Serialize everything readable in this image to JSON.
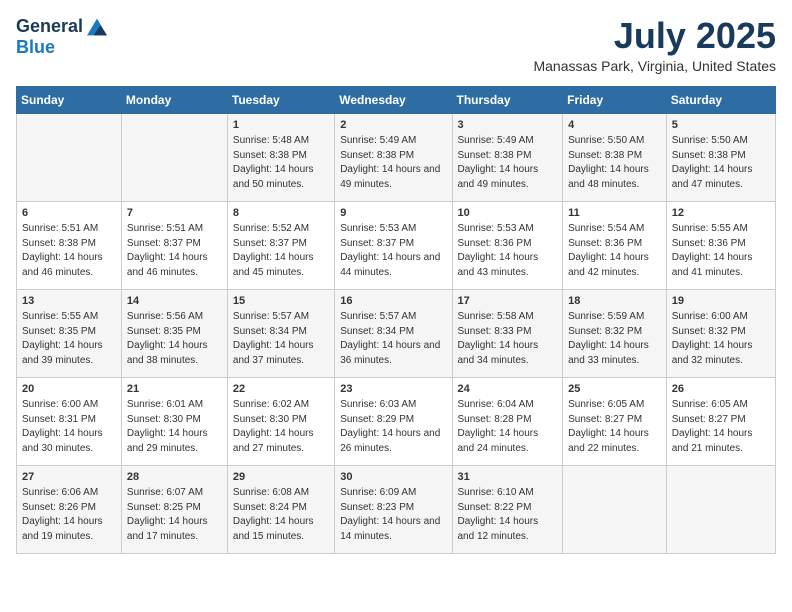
{
  "header": {
    "logo_general": "General",
    "logo_blue": "Blue",
    "month_title": "July 2025",
    "location": "Manassas Park, Virginia, United States"
  },
  "days_of_week": [
    "Sunday",
    "Monday",
    "Tuesday",
    "Wednesday",
    "Thursday",
    "Friday",
    "Saturday"
  ],
  "weeks": [
    [
      {
        "day": "",
        "info": ""
      },
      {
        "day": "",
        "info": ""
      },
      {
        "day": "1",
        "info": "Sunrise: 5:48 AM\nSunset: 8:38 PM\nDaylight: 14 hours and 50 minutes."
      },
      {
        "day": "2",
        "info": "Sunrise: 5:49 AM\nSunset: 8:38 PM\nDaylight: 14 hours and 49 minutes."
      },
      {
        "day": "3",
        "info": "Sunrise: 5:49 AM\nSunset: 8:38 PM\nDaylight: 14 hours and 49 minutes."
      },
      {
        "day": "4",
        "info": "Sunrise: 5:50 AM\nSunset: 8:38 PM\nDaylight: 14 hours and 48 minutes."
      },
      {
        "day": "5",
        "info": "Sunrise: 5:50 AM\nSunset: 8:38 PM\nDaylight: 14 hours and 47 minutes."
      }
    ],
    [
      {
        "day": "6",
        "info": "Sunrise: 5:51 AM\nSunset: 8:38 PM\nDaylight: 14 hours and 46 minutes."
      },
      {
        "day": "7",
        "info": "Sunrise: 5:51 AM\nSunset: 8:37 PM\nDaylight: 14 hours and 46 minutes."
      },
      {
        "day": "8",
        "info": "Sunrise: 5:52 AM\nSunset: 8:37 PM\nDaylight: 14 hours and 45 minutes."
      },
      {
        "day": "9",
        "info": "Sunrise: 5:53 AM\nSunset: 8:37 PM\nDaylight: 14 hours and 44 minutes."
      },
      {
        "day": "10",
        "info": "Sunrise: 5:53 AM\nSunset: 8:36 PM\nDaylight: 14 hours and 43 minutes."
      },
      {
        "day": "11",
        "info": "Sunrise: 5:54 AM\nSunset: 8:36 PM\nDaylight: 14 hours and 42 minutes."
      },
      {
        "day": "12",
        "info": "Sunrise: 5:55 AM\nSunset: 8:36 PM\nDaylight: 14 hours and 41 minutes."
      }
    ],
    [
      {
        "day": "13",
        "info": "Sunrise: 5:55 AM\nSunset: 8:35 PM\nDaylight: 14 hours and 39 minutes."
      },
      {
        "day": "14",
        "info": "Sunrise: 5:56 AM\nSunset: 8:35 PM\nDaylight: 14 hours and 38 minutes."
      },
      {
        "day": "15",
        "info": "Sunrise: 5:57 AM\nSunset: 8:34 PM\nDaylight: 14 hours and 37 minutes."
      },
      {
        "day": "16",
        "info": "Sunrise: 5:57 AM\nSunset: 8:34 PM\nDaylight: 14 hours and 36 minutes."
      },
      {
        "day": "17",
        "info": "Sunrise: 5:58 AM\nSunset: 8:33 PM\nDaylight: 14 hours and 34 minutes."
      },
      {
        "day": "18",
        "info": "Sunrise: 5:59 AM\nSunset: 8:32 PM\nDaylight: 14 hours and 33 minutes."
      },
      {
        "day": "19",
        "info": "Sunrise: 6:00 AM\nSunset: 8:32 PM\nDaylight: 14 hours and 32 minutes."
      }
    ],
    [
      {
        "day": "20",
        "info": "Sunrise: 6:00 AM\nSunset: 8:31 PM\nDaylight: 14 hours and 30 minutes."
      },
      {
        "day": "21",
        "info": "Sunrise: 6:01 AM\nSunset: 8:30 PM\nDaylight: 14 hours and 29 minutes."
      },
      {
        "day": "22",
        "info": "Sunrise: 6:02 AM\nSunset: 8:30 PM\nDaylight: 14 hours and 27 minutes."
      },
      {
        "day": "23",
        "info": "Sunrise: 6:03 AM\nSunset: 8:29 PM\nDaylight: 14 hours and 26 minutes."
      },
      {
        "day": "24",
        "info": "Sunrise: 6:04 AM\nSunset: 8:28 PM\nDaylight: 14 hours and 24 minutes."
      },
      {
        "day": "25",
        "info": "Sunrise: 6:05 AM\nSunset: 8:27 PM\nDaylight: 14 hours and 22 minutes."
      },
      {
        "day": "26",
        "info": "Sunrise: 6:05 AM\nSunset: 8:27 PM\nDaylight: 14 hours and 21 minutes."
      }
    ],
    [
      {
        "day": "27",
        "info": "Sunrise: 6:06 AM\nSunset: 8:26 PM\nDaylight: 14 hours and 19 minutes."
      },
      {
        "day": "28",
        "info": "Sunrise: 6:07 AM\nSunset: 8:25 PM\nDaylight: 14 hours and 17 minutes."
      },
      {
        "day": "29",
        "info": "Sunrise: 6:08 AM\nSunset: 8:24 PM\nDaylight: 14 hours and 15 minutes."
      },
      {
        "day": "30",
        "info": "Sunrise: 6:09 AM\nSunset: 8:23 PM\nDaylight: 14 hours and 14 minutes."
      },
      {
        "day": "31",
        "info": "Sunrise: 6:10 AM\nSunset: 8:22 PM\nDaylight: 14 hours and 12 minutes."
      },
      {
        "day": "",
        "info": ""
      },
      {
        "day": "",
        "info": ""
      }
    ]
  ]
}
